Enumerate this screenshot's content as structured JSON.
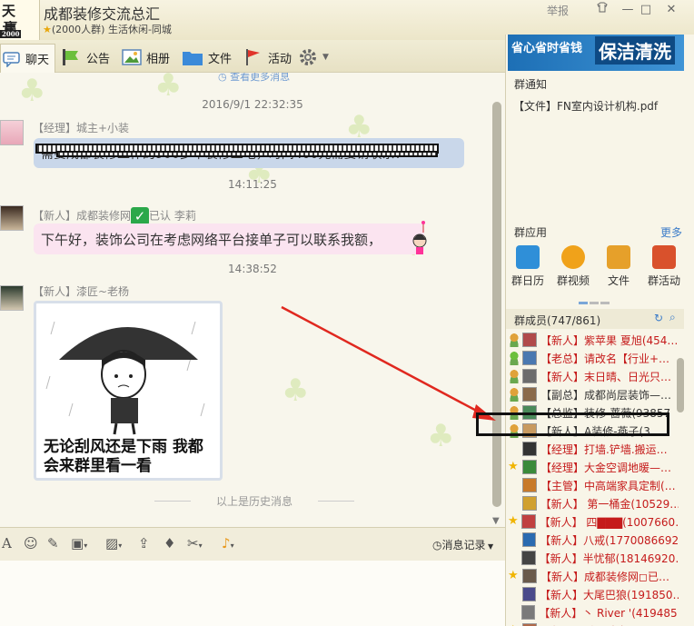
{
  "window": {
    "logo_line1": "天 共",
    "logo_line2": "赢",
    "logo_year": "2000",
    "group_name": "成都装修交流总汇",
    "group_sub": "(2000人群) 生活休闲-同城",
    "report_label": "举报",
    "minimize_glyph": "—",
    "restore_glyph": "□",
    "close_glyph": "✕"
  },
  "tabs": [
    {
      "label": "聊天"
    },
    {
      "label": "公告"
    },
    {
      "label": "相册"
    },
    {
      "label": "文件"
    },
    {
      "label": "活动"
    }
  ],
  "chat": {
    "more_messages": "查看更多消息",
    "messages": [
      {
        "timestamp": "2016/9/1 22:32:35",
        "sender": "【经理】城主+小装",
        "text": "需要成都装修工作的900多平装修工地，时间400元需要请联系！"
      },
      {
        "timestamp": "14:11:25",
        "sender": "【新人】成都装修网",
        "sender_suffix": "已认  李莉",
        "text": "下午好，装饰公司在考虑网络平台接单子可以联系我额，"
      },
      {
        "timestamp": "14:38:52",
        "sender": "【新人】漆匠~老杨",
        "text": "无论刮风还是下雨 我都会来群里看一看"
      }
    ],
    "history_note": "以上是历史消息"
  },
  "input_toolbar": {
    "message_record": "消息记录"
  },
  "right_panel": {
    "ad_text_left": "省心省时省钱",
    "ad_text_right": "保洁清洗",
    "notice_title": "群通知",
    "notice_item": "【文件】FN室内设计机构.pdf",
    "apps_title": "群应用",
    "apps_more": "更多",
    "apps": [
      {
        "label": "群日历",
        "color": "#2f8fd8"
      },
      {
        "label": "群视频",
        "color": "#f0a21a"
      },
      {
        "label": "文件",
        "color": "#e6a02a"
      },
      {
        "label": "群活动",
        "color": "#d9512c"
      }
    ],
    "members_title": "群成员(747/861)",
    "members": [
      {
        "text": "【新人】紫苹果 夏旭(454…",
        "red": true
      },
      {
        "text": "【老总】请改名【行业+…",
        "red": true
      },
      {
        "text": "【新人】末日晴、日光只…",
        "red": true
      },
      {
        "text": "【副总】成都尚层装饰—…",
        "red": false
      },
      {
        "text": "【总监】装修-蔷薇(93857",
        "red": false
      },
      {
        "text": "【新人】A装修-燕子(3…",
        "red": false
      },
      {
        "text": "【经理】打墙.铲墙.搬运…",
        "red": true
      },
      {
        "text": "【经理】大金空调地暖—…",
        "red": true
      },
      {
        "text": "【主管】中高端家具定制(…",
        "red": true
      },
      {
        "text": "【新人】 第一桶金(10529…",
        "red": true
      },
      {
        "text": "【新人】 四▇▇▇(1007660…",
        "red": true
      },
      {
        "text": "【新人】八戒(1770086692)",
        "red": true
      },
      {
        "text": "【新人】半忧郁(18146920…",
        "red": true
      },
      {
        "text": "【新人】成都装修网◻已…",
        "red": true
      },
      {
        "text": "【新人】大尾巴狼(191850…",
        "red": true
      },
      {
        "text": "【新人】丶 River '(419485…",
        "red": true
      },
      {
        "text": "【新人】融设计空间(…",
        "red": true
      }
    ]
  }
}
